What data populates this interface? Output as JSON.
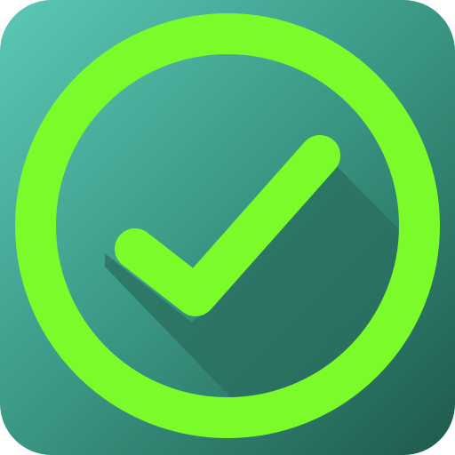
{
  "icon": {
    "name": "check-circle-icon",
    "colors": {
      "background_gradient_start": "#5cc8b6",
      "background_gradient_mid": "#3a9683",
      "background_gradient_end": "#1e5a4c",
      "ring": "#7bfc2a",
      "check": "#7bfc2a",
      "long_shadow": "#2a6e5e"
    }
  }
}
